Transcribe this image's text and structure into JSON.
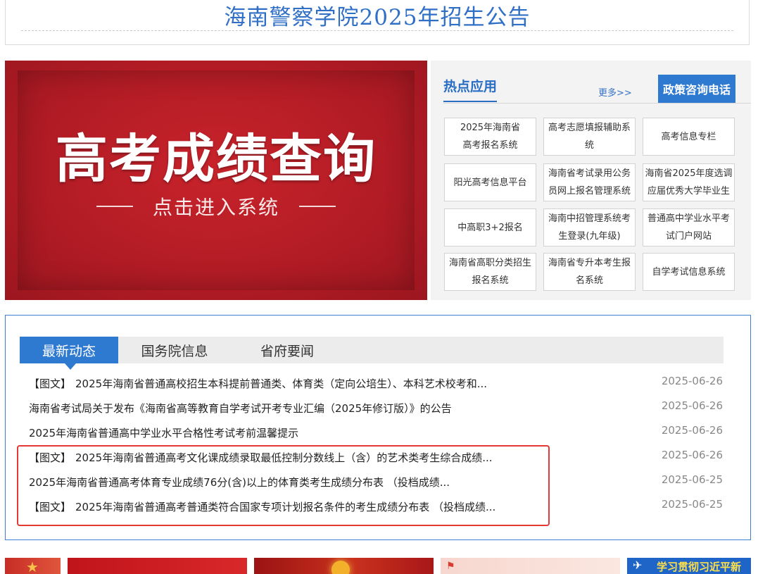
{
  "notice": {
    "title": "海南警察学院2025年招生公告"
  },
  "banner": {
    "title": "高考成绩查询",
    "subtitle": "点击进入系统"
  },
  "apps": {
    "title": "热点应用",
    "more": "更多>>",
    "hotline": "政策咨询电话",
    "items": [
      {
        "label": "2025年海南省高考报名系统"
      },
      {
        "label": "高考志愿填报辅助系统"
      },
      {
        "label": "高考信息专栏"
      },
      {
        "label": "阳光高考信息平台"
      },
      {
        "label": "海南省考试录用公务员网上报名管理系统"
      },
      {
        "label": "海南省2025年度选调应届优秀大学毕业生"
      },
      {
        "label": "中高职3+2报名"
      },
      {
        "label": "海南中招管理系统考生登录(九年级)"
      },
      {
        "label": "普通高中学业水平考试门户网站"
      },
      {
        "label": "海南省高职分类招生报名系统"
      },
      {
        "label": "海南省专升本考生报名系统"
      },
      {
        "label": "自学考试信息系统"
      }
    ]
  },
  "news": {
    "tabs": [
      {
        "label": "最新动态",
        "active": true
      },
      {
        "label": "国务院信息",
        "active": false
      },
      {
        "label": "省府要闻",
        "active": false
      }
    ],
    "items": [
      {
        "prefix": "【图文】",
        "title": "2025年海南省普通高校招生本科提前普通类、体育类（定向公培生）、本科艺术校考和...",
        "date": "2025-06-26"
      },
      {
        "prefix": "",
        "title": "海南省考试局关于发布《海南省高等教育自学考试开考专业汇编（2025年修订版）》的公告",
        "date": "2025-06-26"
      },
      {
        "prefix": "",
        "title": "2025年海南省普通高中学业水平合格性考试考前温馨提示",
        "date": "2025-06-26"
      },
      {
        "prefix": "【图文】",
        "title": "2025年海南省普通高考文化课成绩录取最低控制分数线上（含）的艺术类考生综合成绩...",
        "date": "2025-06-26"
      },
      {
        "prefix": "",
        "title": "2025年海南省普通高考体育专业成绩76分(含)以上的体育类考生成绩分布表 （投档成绩...",
        "date": "2025-06-25"
      },
      {
        "prefix": "【图文】",
        "title": "2025年海南省普通高考普通类符合国家专项计划报名条件的考生成绩分布表 （投档成绩...",
        "date": "2025-06-25"
      }
    ]
  },
  "bottom": {
    "banner5_text": "学习贯彻习近平新"
  },
  "colors": {
    "accent_blue": "#2f7ad1",
    "banner_red": "#b31c25",
    "highlight_red": "#e53935"
  }
}
